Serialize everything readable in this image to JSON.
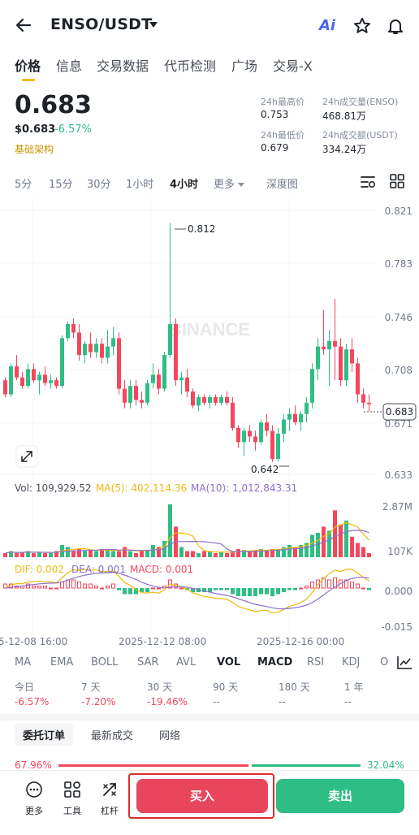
{
  "header": {
    "pair": "ENSO/USDT",
    "ai_label": "Ai"
  },
  "tabs": [
    "价格",
    "信息",
    "交易数据",
    "代币检测",
    "广场",
    "交易-X"
  ],
  "price": {
    "last": "0.683",
    "fiat": "$0.683",
    "change_pct": "-6.57%",
    "category": "基础架构"
  },
  "stats": {
    "high_label": "24h最高价",
    "high_value": "0.753",
    "vol_base_label": "24h成交量(ENSO)",
    "vol_base_value": "468.81万",
    "low_label": "24h最低价",
    "low_value": "0.679",
    "vol_quote_label": "24h成交额(USDT)",
    "vol_quote_value": "334.24万"
  },
  "intervals": [
    "5分",
    "15分",
    "30分",
    "1小时",
    "4小时",
    "更多",
    "深度图"
  ],
  "chart": {
    "watermark": "BINANCE",
    "y_ticks": [
      "0.821",
      "0.783",
      "0.746",
      "0.708",
      "0.671",
      "0.633"
    ],
    "high_annotation": "0.812",
    "low_annotation": "0.642",
    "current_price_tag": "0.683",
    "vol_legend": "Vol: 109,929.52",
    "ma5_legend": "MA(5): 402,114.36",
    "ma10_legend": "MA(10): 1,012,843.31",
    "vol_ticks": [
      "2.87M",
      "107K"
    ],
    "dif_legend": "DIF: 0.002",
    "dea_legend": "DEA: 0.001",
    "macd_legend": "MACD: 0.001",
    "macd_ticks": [
      "0.000",
      "-0.015"
    ],
    "x_ticks": [
      "5-12-08 16:00",
      "2025-12-12 08:00",
      "2025-12-16 00:00"
    ],
    "colors": {
      "up": "#2ebd85",
      "down": "#f6465d",
      "ma5": "#f0b90b",
      "ma10": "#8c6fc7",
      "dif": "#f0b90b",
      "dea": "#8c6fc7"
    }
  },
  "chart_data": {
    "type": "candlestick",
    "y_range": [
      0.633,
      0.821
    ],
    "high": 0.812,
    "low": 0.642,
    "last": 0.683,
    "candles": [
      [
        0.7,
        0.702,
        0.688,
        0.69
      ],
      [
        0.69,
        0.712,
        0.688,
        0.71
      ],
      [
        0.71,
        0.718,
        0.7,
        0.702
      ],
      [
        0.702,
        0.706,
        0.694,
        0.696
      ],
      [
        0.696,
        0.712,
        0.694,
        0.708
      ],
      [
        0.708,
        0.712,
        0.698,
        0.7
      ],
      [
        0.7,
        0.706,
        0.69,
        0.704
      ],
      [
        0.704,
        0.71,
        0.696,
        0.698
      ],
      [
        0.698,
        0.704,
        0.694,
        0.7
      ],
      [
        0.7,
        0.702,
        0.694,
        0.696
      ],
      [
        0.696,
        0.732,
        0.694,
        0.73
      ],
      [
        0.73,
        0.742,
        0.728,
        0.74
      ],
      [
        0.74,
        0.744,
        0.73,
        0.734
      ],
      [
        0.734,
        0.74,
        0.714,
        0.718
      ],
      [
        0.718,
        0.728,
        0.712,
        0.726
      ],
      [
        0.726,
        0.734,
        0.716,
        0.72
      ],
      [
        0.72,
        0.73,
        0.716,
        0.726
      ],
      [
        0.726,
        0.73,
        0.712,
        0.716
      ],
      [
        0.716,
        0.736,
        0.712,
        0.724
      ],
      [
        0.724,
        0.738,
        0.718,
        0.73
      ],
      [
        0.73,
        0.734,
        0.69,
        0.694
      ],
      [
        0.694,
        0.7,
        0.68,
        0.684
      ],
      [
        0.684,
        0.7,
        0.68,
        0.696
      ],
      [
        0.696,
        0.7,
        0.682,
        0.686
      ],
      [
        0.686,
        0.692,
        0.68,
        0.684
      ],
      [
        0.684,
        0.7,
        0.682,
        0.698
      ],
      [
        0.698,
        0.712,
        0.694,
        0.704
      ],
      [
        0.704,
        0.708,
        0.69,
        0.694
      ],
      [
        0.694,
        0.72,
        0.692,
        0.718
      ],
      [
        0.718,
        0.812,
        0.716,
        0.74
      ],
      [
        0.74,
        0.744,
        0.696,
        0.7
      ],
      [
        0.7,
        0.706,
        0.69,
        0.702
      ],
      [
        0.702,
        0.708,
        0.688,
        0.692
      ],
      [
        0.692,
        0.694,
        0.68,
        0.682
      ],
      [
        0.682,
        0.69,
        0.678,
        0.688
      ],
      [
        0.688,
        0.69,
        0.682,
        0.684
      ],
      [
        0.684,
        0.69,
        0.68,
        0.688
      ],
      [
        0.688,
        0.69,
        0.682,
        0.684
      ],
      [
        0.684,
        0.69,
        0.682,
        0.688
      ],
      [
        0.688,
        0.692,
        0.682,
        0.684
      ],
      [
        0.684,
        0.688,
        0.664,
        0.666
      ],
      [
        0.666,
        0.668,
        0.652,
        0.656
      ],
      [
        0.656,
        0.666,
        0.646,
        0.664
      ],
      [
        0.664,
        0.668,
        0.656,
        0.66
      ],
      [
        0.66,
        0.664,
        0.65,
        0.656
      ],
      [
        0.656,
        0.672,
        0.654,
        0.67
      ],
      [
        0.67,
        0.676,
        0.66,
        0.664
      ],
      [
        0.664,
        0.668,
        0.642,
        0.644
      ],
      [
        0.644,
        0.666,
        0.642,
        0.662
      ],
      [
        0.662,
        0.676,
        0.656,
        0.672
      ],
      [
        0.672,
        0.68,
        0.664,
        0.676
      ],
      [
        0.676,
        0.682,
        0.668,
        0.67
      ],
      [
        0.67,
        0.678,
        0.664,
        0.676
      ],
      [
        0.676,
        0.688,
        0.67,
        0.684
      ],
      [
        0.684,
        0.712,
        0.68,
        0.708
      ],
      [
        0.708,
        0.73,
        0.7,
        0.724
      ],
      [
        0.724,
        0.75,
        0.718,
        0.722
      ],
      [
        0.722,
        0.736,
        0.696,
        0.728
      ],
      [
        0.728,
        0.758,
        0.7,
        0.724
      ],
      [
        0.724,
        0.73,
        0.696,
        0.7
      ],
      [
        0.7,
        0.726,
        0.696,
        0.722
      ],
      [
        0.722,
        0.73,
        0.706,
        0.712
      ],
      [
        0.712,
        0.716,
        0.684,
        0.69
      ],
      [
        0.69,
        0.694,
        0.68,
        0.684
      ],
      [
        0.684,
        0.69,
        0.678,
        0.683
      ]
    ],
    "volume_range": [
      0,
      2.87
    ],
    "volumes": [
      0.2,
      0.3,
      0.2,
      0.25,
      0.3,
      0.2,
      0.25,
      0.2,
      0.2,
      0.3,
      0.6,
      0.5,
      0.3,
      0.4,
      0.3,
      0.35,
      0.3,
      0.4,
      0.35,
      0.3,
      0.3,
      0.5,
      0.3,
      0.2,
      0.3,
      0.35,
      0.6,
      0.5,
      0.8,
      2.6,
      1.5,
      0.5,
      0.3,
      0.3,
      0.2,
      0.3,
      0.3,
      0.2,
      0.25,
      0.2,
      0.3,
      0.4,
      0.35,
      0.3,
      0.3,
      0.4,
      0.35,
      0.4,
      0.4,
      0.5,
      0.6,
      0.5,
      0.6,
      0.7,
      1.1,
      1.2,
      1.5,
      1.3,
      2.3,
      1.6,
      1.8,
      1.0,
      0.7,
      0.5,
      0.2
    ],
    "macd_range": [
      -0.02,
      0.01
    ],
    "macd_hist": [
      0.002,
      0.002,
      0.001,
      0.001,
      0.002,
      0.001,
      0.001,
      0.001,
      0.0,
      0.0,
      0.003,
      0.004,
      0.004,
      0.003,
      0.002,
      0.002,
      0.001,
      0.0,
      0.001,
      0.002,
      -0.001,
      -0.003,
      -0.003,
      -0.003,
      -0.002,
      -0.002,
      0.0,
      0.0,
      0.001,
      0.004,
      0.002,
      0.0,
      -0.001,
      -0.002,
      -0.002,
      -0.002,
      -0.002,
      -0.001,
      -0.001,
      -0.001,
      -0.003,
      -0.004,
      -0.004,
      -0.004,
      -0.004,
      -0.003,
      -0.003,
      -0.004,
      -0.003,
      -0.002,
      -0.001,
      -0.001,
      0.0,
      0.001,
      0.003,
      0.004,
      0.005,
      0.004,
      0.005,
      0.004,
      0.004,
      0.003,
      0.002,
      0.0,
      -0.001
    ]
  },
  "indicators": [
    "MA",
    "EMA",
    "BOLL",
    "SAR",
    "AVL",
    "VOL",
    "MACD",
    "RSI",
    "KDJ",
    "O"
  ],
  "performance": [
    {
      "label": "今日",
      "value": "-6.57%"
    },
    {
      "label": "7 天",
      "value": "-7.20%"
    },
    {
      "label": "30 天",
      "value": "-19.46%"
    },
    {
      "label": "90 天",
      "value": "--"
    },
    {
      "label": "180 天",
      "value": "--"
    },
    {
      "label": "1 年",
      "value": "--"
    }
  ],
  "order_tabs": [
    "委托订单",
    "最新成交",
    "网络"
  ],
  "order_ratio": {
    "buy": "67.96%",
    "sell": "32.04%"
  },
  "bottom": {
    "more": "更多",
    "tools": "工具",
    "leverage": "杠杆",
    "buy": "买入",
    "sell": "卖出"
  }
}
